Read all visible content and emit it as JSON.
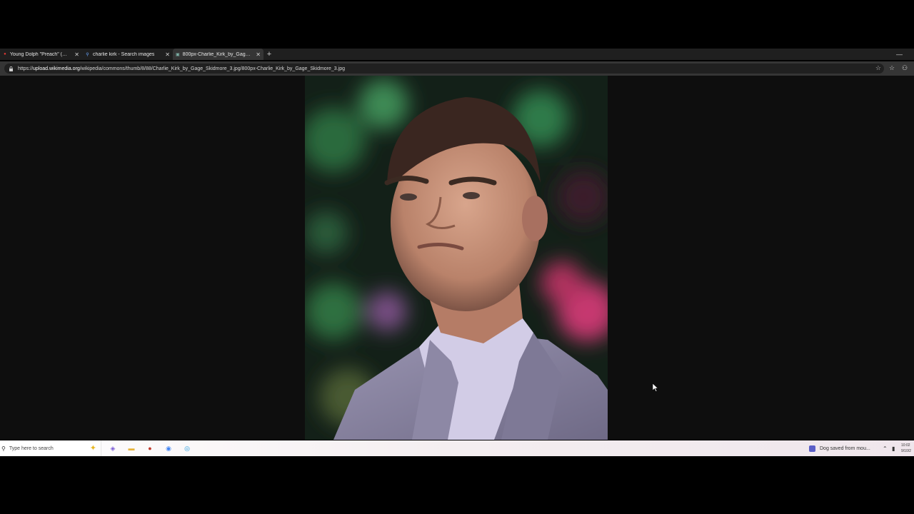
{
  "tabs": [
    {
      "title": "Young Dolph \"Preach\" (WSHH Pr",
      "favicon": "red-video-icon",
      "active": false
    },
    {
      "title": "charlie kirk - Search images",
      "favicon": "search-icon",
      "active": false
    },
    {
      "title": "800px-Charlie_Kirk_by_Gage_Skidmore_3.jpg",
      "favicon": "image-icon",
      "active": true
    }
  ],
  "address_bar": {
    "url_prefix": "https://",
    "url_domain": "upload.wikimedia.org",
    "url_path": "/wikipedia/commons/thumb/8/88/Charlie_Kirk_by_Gage_Skidmore_3.jpg/800px-Charlie_Kirk_by_Gage_Skidmore_3.jpg"
  },
  "taskbar": {
    "search_placeholder": "Type here to search",
    "notification": "Dog saved from mou...",
    "clock_time": "10:02",
    "clock_date": "9/10/2"
  },
  "colors": {
    "tabbar_bg": "#1f1f1f",
    "addressbar_bg": "#353535",
    "page_bg": "#0e0e0e",
    "suit": "#8f8aa6",
    "shirt": "#cfc9e4"
  }
}
